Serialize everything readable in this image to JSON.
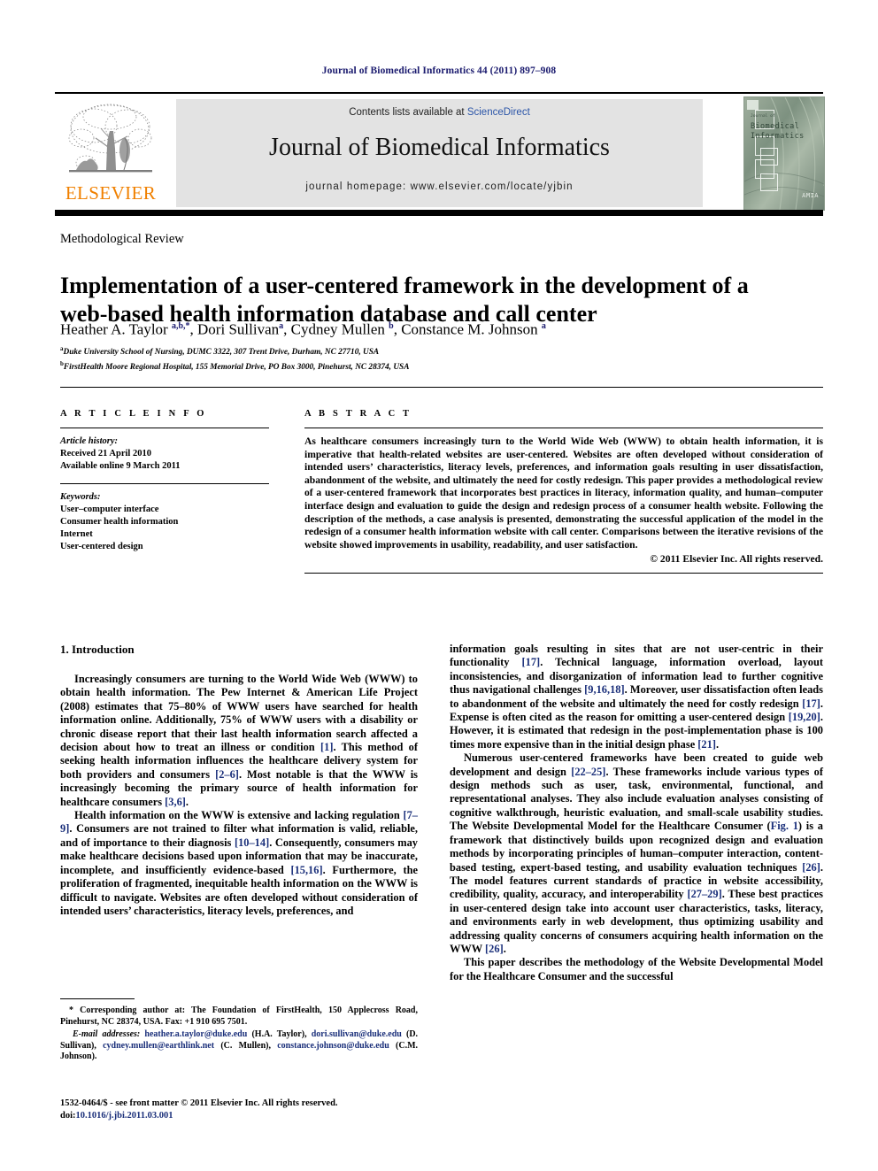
{
  "running_head": "Journal of Biomedical Informatics 44 (2011) 897–908",
  "masthead": {
    "contents_prefix": "Contents lists available at ",
    "sciencedirect": "ScienceDirect",
    "journal_title": "Journal of Biomedical Informatics",
    "homepage": "journal homepage: www.elsevier.com/locate/yjbin",
    "publisher_name": "ELSEVIER",
    "cover_line1": "Biomedical",
    "cover_line2": "Informatics",
    "cover_tiny": "Journal of",
    "cover_badge": "AMIA",
    "accent_link_color": "#2b55a8",
    "publisher_color": "#F08000"
  },
  "article": {
    "section_label": "Methodological Review",
    "title": "Implementation of a user-centered framework in the development of a web-based health information database and call center",
    "authors_html": "Heather A. Taylor <sup>a,b,*</sup>, Dori Sullivan<sup>a</sup>, Cydney Mullen <sup>b</sup>, Constance M. Johnson <sup>a</sup>",
    "affiliation_a": "Duke University School of Nursing, DUMC 3322, 307 Trent Drive, Durham, NC 27710, USA",
    "affiliation_b": "FirstHealth Moore Regional Hospital, 155 Memorial Drive, PO Box 3000, Pinehurst, NC 28374, USA"
  },
  "info": {
    "heading": "A R T I C L E   I N F O",
    "history_label": "Article history:",
    "history_lines": [
      "Received 21 April 2010",
      "Available online 9 March 2011"
    ],
    "keywords_label": "Keywords:",
    "keywords": [
      "User–computer interface",
      "Consumer health information",
      "Internet",
      "User-centered design"
    ]
  },
  "abstract": {
    "heading": "A B S T R A C T",
    "text": "As healthcare consumers increasingly turn to the World Wide Web (WWW) to obtain health information, it is imperative that health-related websites are user-centered. Websites are often developed without consideration of intended users’ characteristics, literacy levels, preferences, and information goals resulting in user dissatisfaction, abandonment of the website, and ultimately the need for costly redesign. This paper provides a methodological review of a user-centered framework that incorporates best practices in literacy, information quality, and human–computer interface design and evaluation to guide the design and redesign process of a consumer health website. Following the description of the methods, a case analysis is presented, demonstrating the successful application of the model in the redesign of a consumer health information website with call center. Comparisons between the iterative revisions of the website showed improvements in usability, readability, and user satisfaction.",
    "copyright": "© 2011 Elsevier Inc. All rights reserved."
  },
  "body": {
    "intro_heading": "1. Introduction",
    "left_paragraphs": [
      "Increasingly consumers are turning to the World Wide Web (WWW) to obtain health information. The Pew Internet & American Life Project (2008) estimates that 75–80% of WWW users have searched for health information online. Additionally, 75% of WWW users with a disability or chronic disease report that their last health information search affected a decision about how to treat an illness or condition [1]. This method of seeking health information influences the healthcare delivery system for both providers and consumers [2–6]. Most notable is that the WWW is increasingly becoming the primary source of health information for healthcare consumers [3,6].",
      "Health information on the WWW is extensive and lacking regulation [7–9]. Consumers are not trained to filter what information is valid, reliable, and of importance to their diagnosis [10–14]. Consequently, consumers may make healthcare decisions based upon information that may be inaccurate, incomplete, and insufficiently evidence-based [15,16]. Furthermore, the proliferation of fragmented, inequitable health information on the WWW is difficult to navigate. Websites are often developed without consideration of intended users’ characteristics, literacy levels, preferences, and"
    ],
    "right_paragraphs": [
      "information goals resulting in sites that are not user-centric in their functionality [17]. Technical language, information overload, layout inconsistencies, and disorganization of information lead to further cognitive thus navigational challenges [9,16,18]. Moreover, user dissatisfaction often leads to abandonment of the website and ultimately the need for costly redesign [17]. Expense is often cited as the reason for omitting a user-centered design [19,20]. However, it is estimated that redesign in the post-implementation phase is 100 times more expensive than in the initial design phase [21].",
      "Numerous user-centered frameworks have been created to guide web development and design [22–25]. These frameworks include various types of design methods such as user, task, environmental, functional, and representational analyses. They also include evaluation analyses consisting of cognitive walkthrough, heuristic evaluation, and small-scale usability studies. The Website Developmental Model for the Healthcare Consumer (Fig. 1) is a framework that distinctively builds upon recognized design and evaluation methods by incorporating principles of human–computer interaction, content-based testing, expert-based testing, and usability evaluation techniques [26]. The model features current standards of practice in website accessibility, credibility, quality, accuracy, and interoperability [27–29]. These best practices in user-centered design take into account user characteristics, tasks, literacy, and environments early in web development, thus optimizing usability and addressing quality concerns of consumers acquiring health information on the WWW [26].",
      "This paper describes the methodology of the Website Developmental Model for the Healthcare Consumer and the successful"
    ]
  },
  "footnote": {
    "corresponding": "* Corresponding author at: The Foundation of FirstHealth, 150 Applecross Road, Pinehurst, NC 28374, USA. Fax: +1 910 695 7501.",
    "email_label": "E-mail addresses:",
    "emails": [
      {
        "address": "heather.a.taylor@duke.edu",
        "name": "(H.A. Taylor)"
      },
      {
        "address": "dori.sullivan@duke.edu",
        "name": "(D. Sullivan)"
      },
      {
        "address": "cydney.mullen@earthlink.net",
        "name": "(C. Mullen)"
      },
      {
        "address": "constance.johnson@duke.edu",
        "name": "(C.M. Johnson)"
      }
    ]
  },
  "imprint": {
    "line1": "1532-0464/$ - see front matter © 2011 Elsevier Inc. All rights reserved.",
    "doi_prefix": "doi:",
    "doi": "10.1016/j.jbi.2011.03.001"
  }
}
